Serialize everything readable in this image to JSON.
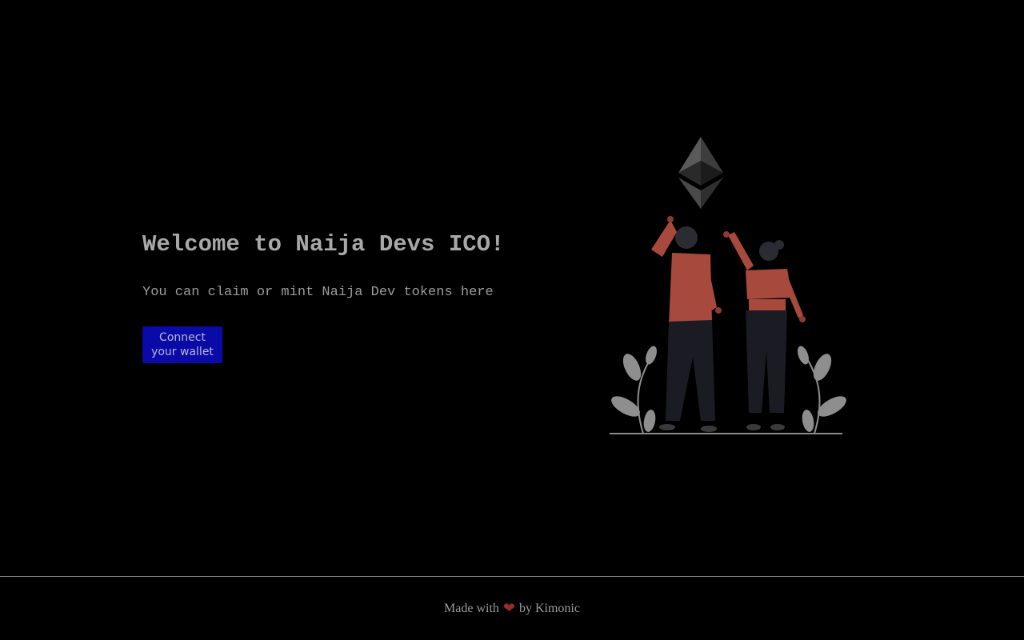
{
  "hero": {
    "title": "Welcome to Naija Devs ICO!",
    "description": "You can claim or mint Naija Dev tokens here",
    "connect_button_label": "Connect your wallet"
  },
  "illustration": {
    "icon": "ethereum-logo-icon"
  },
  "footer": {
    "prefix": "Made with",
    "heart": "❤",
    "suffix": "by Kimonic"
  },
  "colors": {
    "background": "#000000",
    "button": "#0a0aa8",
    "heart": "#9b2b27",
    "shirt": "#a8493d"
  }
}
